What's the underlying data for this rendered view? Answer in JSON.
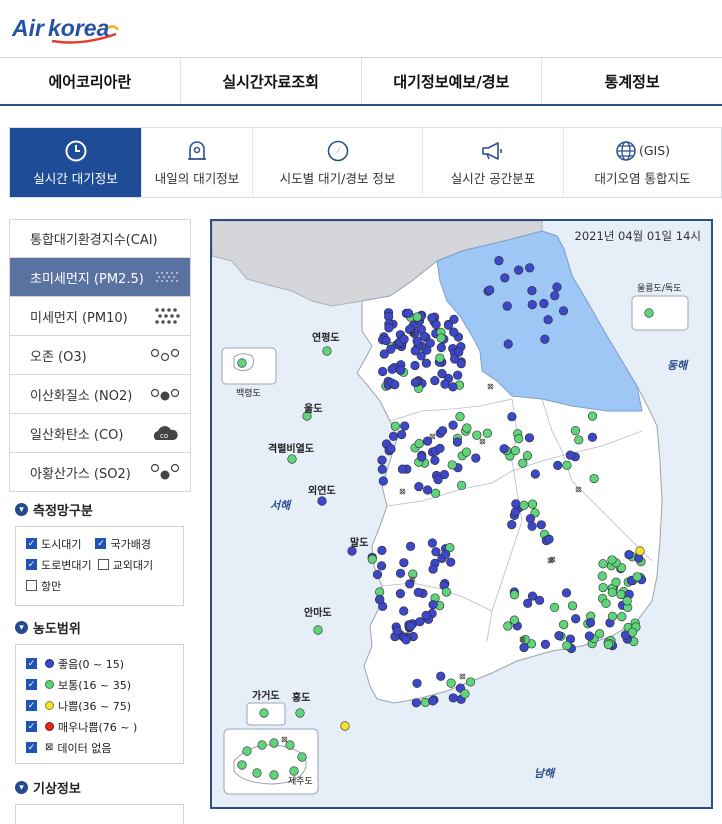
{
  "logo": {
    "part1": "Air",
    "part2": "korea"
  },
  "gnb": [
    "에어코리아란",
    "실시간자료조회",
    "대기정보예보/경보",
    "통계정보"
  ],
  "subtabs": [
    {
      "label": "실시간 대기정보",
      "icon": "clock-icon",
      "active": true
    },
    {
      "label": "내일의 대기정보",
      "icon": "tomorrow-icon",
      "active": false
    },
    {
      "label": "시도별 대기/경보 정보",
      "icon": "compass-icon",
      "active": false
    },
    {
      "label": "실시간 공간분포",
      "icon": "megaphone-icon",
      "active": false
    },
    {
      "label": "대기오염 통합지도",
      "icon": "globe-icon",
      "active": false,
      "tag": "(GIS)"
    }
  ],
  "pollutants": [
    {
      "label": "통합대기환경지수(CAI)",
      "active": false
    },
    {
      "label": "초미세먼지 (PM2.5)",
      "active": true
    },
    {
      "label": "미세먼지 (PM10)",
      "active": false
    },
    {
      "label": "오존 (O3)",
      "active": false
    },
    {
      "label": "이산화질소 (NO2)",
      "active": false
    },
    {
      "label": "일산화탄소 (CO)",
      "active": false
    },
    {
      "label": "아황산가스 (SO2)",
      "active": false
    }
  ],
  "network": {
    "title": "측정망구분",
    "items": [
      {
        "label": "도시대기",
        "checked": true
      },
      {
        "label": "국가배경",
        "checked": true
      },
      {
        "label": "도로변대기",
        "checked": true
      },
      {
        "label": "교외대기",
        "checked": false
      },
      {
        "label": "항만",
        "checked": false
      }
    ]
  },
  "range": {
    "title": "농도범위",
    "items": [
      {
        "label": "좋음(0 ~ 15)",
        "color": "#3d47c9"
      },
      {
        "label": "보통(16 ~ 35)",
        "color": "#5fd47a"
      },
      {
        "label": "나쁨(36 ~ 75)",
        "color": "#f2e22a"
      },
      {
        "label": "매우나쁨(76 ~ )",
        "color": "#e02a1e"
      },
      {
        "label": "데이터 없음",
        "color": "none"
      }
    ]
  },
  "weather": {
    "title": "기상정보"
  },
  "map": {
    "timestamp": "2021년 04월 01일 14시",
    "islands": [
      "연평도",
      "울도",
      "격렬비열도",
      "외연도",
      "말도",
      "안마도",
      "가거도",
      "홍도",
      "백령도",
      "울릉도/독도",
      "제주도"
    ],
    "seas": [
      "동해",
      "서해",
      "남해"
    ],
    "colors": {
      "good": "#3d47c9",
      "normal": "#5fd47a",
      "bad": "#f2e22a",
      "land": "#ffffff",
      "gangwon": "#9fc7f5",
      "sea": "#e6eef8"
    }
  }
}
